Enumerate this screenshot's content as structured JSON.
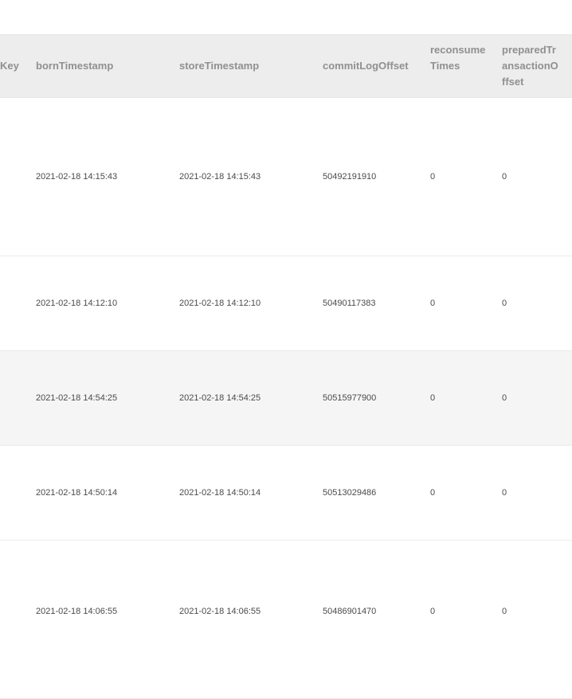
{
  "table": {
    "columns": [
      "Key",
      "bornTimestamp",
      "storeTimestamp",
      "commitLogOffset",
      "reconsume Times",
      "preparedTr ansactionO ffset"
    ],
    "rows": [
      {
        "bornTimestamp": "2021-02-18 14:15:43",
        "storeTimestamp": "2021-02-18 14:15:43",
        "commitLogOffset": "50492191910",
        "reconsumeTimes": "0",
        "preparedTransactionOffset": "0"
      },
      {
        "bornTimestamp": "2021-02-18 14:12:10",
        "storeTimestamp": "2021-02-18 14:12:10",
        "commitLogOffset": "50490117383",
        "reconsumeTimes": "0",
        "preparedTransactionOffset": "0"
      },
      {
        "bornTimestamp": "2021-02-18 14:54:25",
        "storeTimestamp": "2021-02-18 14:54:25",
        "commitLogOffset": "50515977900",
        "reconsumeTimes": "0",
        "preparedTransactionOffset": "0"
      },
      {
        "bornTimestamp": "2021-02-18 14:50:14",
        "storeTimestamp": "2021-02-18 14:50:14",
        "commitLogOffset": "50513029486",
        "reconsumeTimes": "0",
        "preparedTransactionOffset": "0"
      },
      {
        "bornTimestamp": "2021-02-18 14:06:55",
        "storeTimestamp": "2021-02-18 14:06:55",
        "commitLogOffset": "50486901470",
        "reconsumeTimes": "0",
        "preparedTransactionOffset": "0"
      }
    ]
  }
}
